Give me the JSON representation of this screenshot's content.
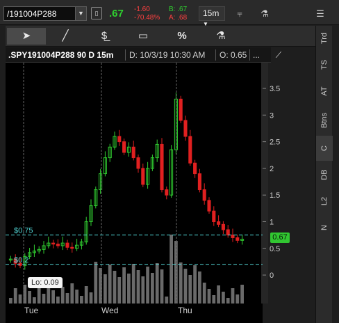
{
  "topbar": {
    "symbol": "/191004P288",
    "dropdown_icon": "triangle-down-icon",
    "last_price": ".67",
    "net_change": "-1.60",
    "pct_change": "-70.48%",
    "bid": "B: .67",
    "ask": "A: .68",
    "timeframe": "15m",
    "timeframe_icon": "triangle-down-icon",
    "menu_icon": "hamburger-icon"
  },
  "toolbar": {
    "cursor_icon": "arrow-cursor-icon",
    "line_icon": "trendline-icon",
    "price_icon": "price-level-icon",
    "rect_icon": "rectangle-icon",
    "percent_label": "%",
    "studies_icon": "beakers-icon"
  },
  "side_tabs": [
    "Trd",
    "TS",
    "AT",
    "Btns",
    "C",
    "DB",
    "L2",
    "N"
  ],
  "side_tabs_active": "C",
  "chart_header": {
    "title": ".SPY191004P288 90 D 15m",
    "date": "D: 10/3/19 10:30 AM",
    "open": "O: 0.65",
    "more": "..."
  },
  "level_labels": {
    "upper": "$0.75",
    "lower": "$0.2"
  },
  "lo_label": "Lo: 0.09",
  "last_price_tag": "0.67",
  "colors": {
    "up": "#30cc30",
    "down": "#e02020",
    "level": "#52d6d6",
    "volume": "#6a6a6a",
    "session_divider": "#555555"
  },
  "chart_data": {
    "type": "candlestick",
    "title": "",
    "xlabel": "",
    "ylabel": "",
    "x_ticks": [
      "Tue",
      "Wed",
      "Thu"
    ],
    "y_ticks": [
      0,
      0.5,
      1,
      1.5,
      2,
      2.5,
      3,
      3.5
    ],
    "ylim": [
      -0.5,
      4.1
    ],
    "price_levels": [
      0.75,
      0.2
    ],
    "last_price": 0.67,
    "low": 0.09,
    "grid": false,
    "session_close_prices": {
      "Tue": 0.5,
      "Wed": 2.35,
      "Thu": 0.67
    },
    "approx_intraday_closes": [
      0.3,
      0.22,
      0.18,
      0.35,
      0.42,
      0.45,
      0.48,
      0.55,
      0.6,
      0.58,
      0.55,
      0.6,
      0.52,
      0.5,
      0.56,
      0.62,
      1.0,
      1.3,
      1.6,
      1.9,
      2.2,
      2.4,
      2.6,
      2.5,
      2.3,
      2.4,
      2.2,
      2.0,
      1.7,
      2.0,
      2.2,
      2.45,
      1.6,
      1.5,
      2.35,
      3.3,
      2.9,
      2.6,
      2.1,
      1.9,
      1.6,
      1.4,
      1.2,
      1.0,
      0.95,
      0.85,
      0.75,
      0.7,
      0.65,
      0.67
    ]
  }
}
